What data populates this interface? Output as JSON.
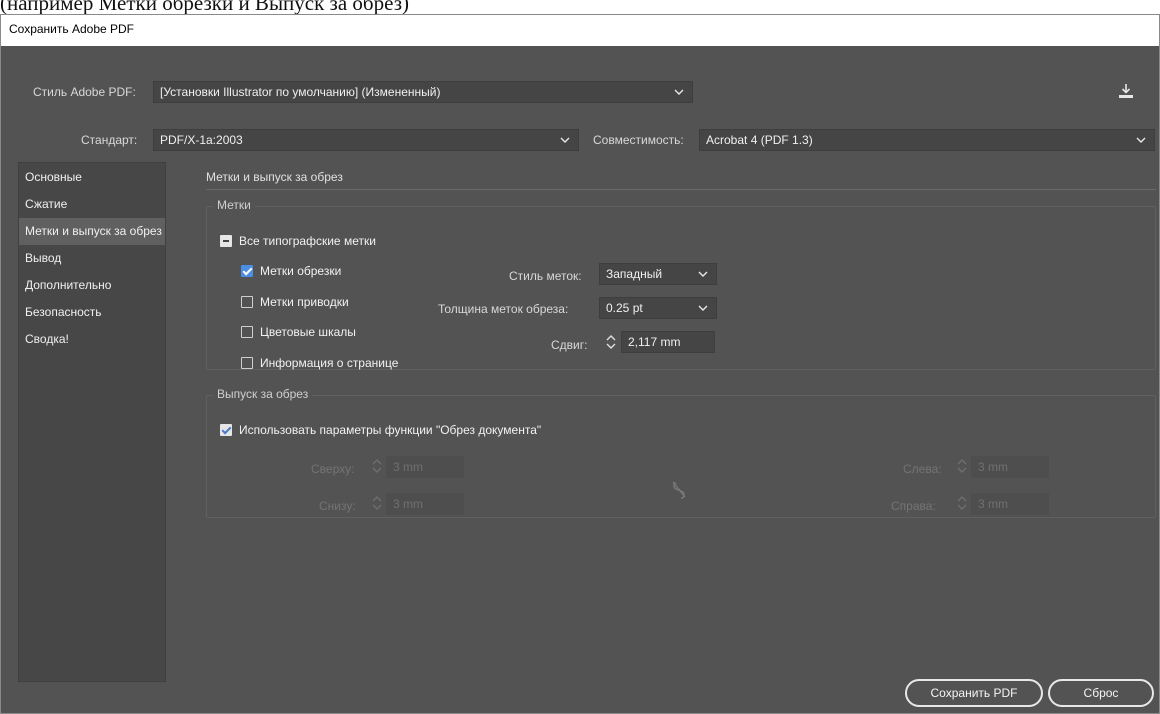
{
  "cutoff_text": "(например Метки обрезки и Выпуск за обрез)",
  "window": {
    "title": "Сохранить Adobe PDF"
  },
  "top": {
    "preset_label": "Стиль Adobe PDF:",
    "preset_value": "[Установки Illustrator по умолчанию] (Измененный)",
    "save_preset_icon": "download-icon",
    "standard_label": "Стандарт:",
    "standard_value": "PDF/X-1a:2003",
    "compat_label": "Совместимость:",
    "compat_value": "Acrobat 4 (PDF 1.3)"
  },
  "nav": {
    "items": [
      {
        "label": "Основные"
      },
      {
        "label": "Сжатие"
      },
      {
        "label": "Метки и выпуск за обрез"
      },
      {
        "label": "Вывод"
      },
      {
        "label": "Дополнительно"
      },
      {
        "label": "Безопасность"
      },
      {
        "label": "Сводка!"
      }
    ],
    "active_index": 2
  },
  "panel": {
    "title": "Метки и выпуск за обрез",
    "marks": {
      "group_title": "Метки",
      "all_marks": "Все типографские метки",
      "trim_marks": "Метки обрезки",
      "registration_marks": "Метки приводки",
      "color_bars": "Цветовые шкалы",
      "page_info": "Информация о странице",
      "style_label": "Стиль меток:",
      "style_value": "Западный",
      "weight_label": "Толщина меток обреза:",
      "weight_value": "0.25 pt",
      "offset_label": "Сдвиг:",
      "offset_value": "2,117 mm"
    },
    "bleed": {
      "group_title": "Выпуск за обрез",
      "use_doc_bleed": "Использовать параметры функции \"Обрез документа\"",
      "top_label": "Сверху:",
      "top_value": "3 mm",
      "bottom_label": "Снизу:",
      "bottom_value": "3 mm",
      "left_label": "Слева:",
      "left_value": "3 mm",
      "right_label": "Справа:",
      "right_value": "3 mm",
      "link_icon": "broken-link-icon"
    }
  },
  "buttons": {
    "save": "Сохранить PDF",
    "reset": "Сброс"
  }
}
